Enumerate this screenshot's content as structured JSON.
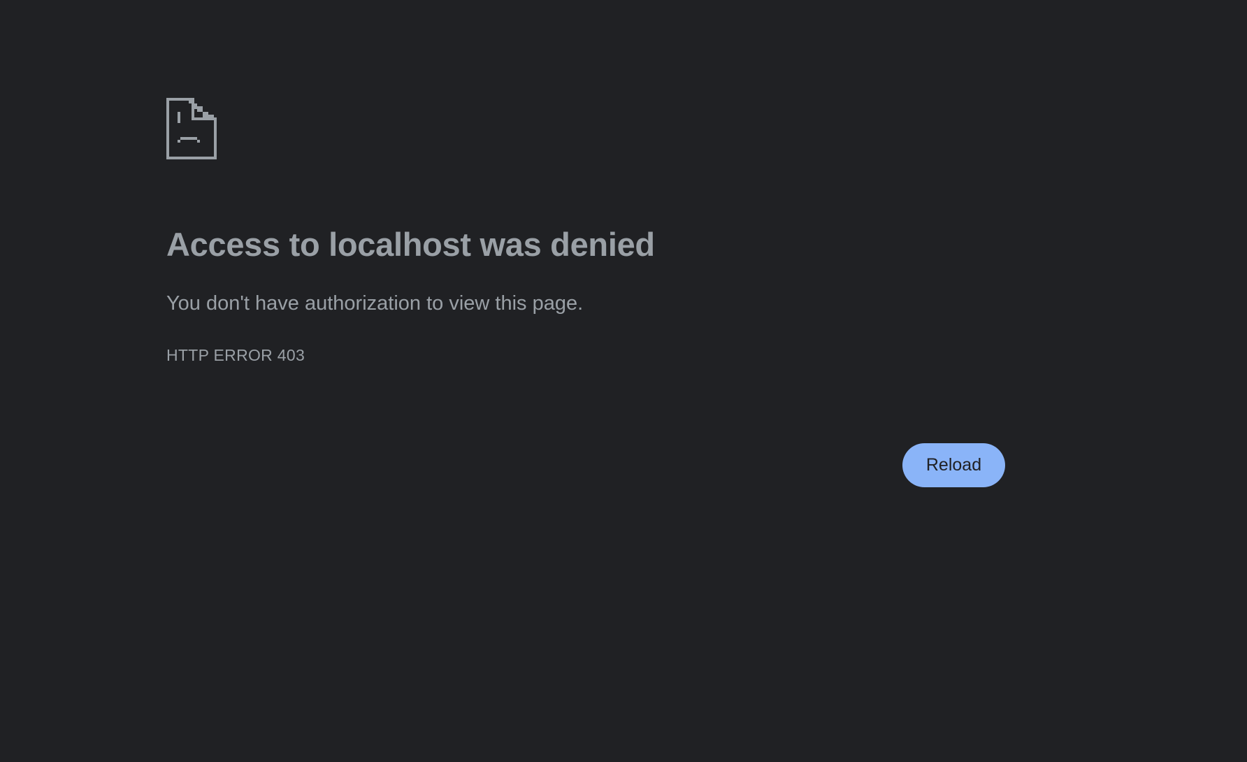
{
  "page": {
    "background_color": "#202124",
    "text_color": "#9aa0a6",
    "accent_color": "#8ab4f8"
  },
  "error": {
    "icon": "sad-document-icon",
    "title": "Access to localhost was denied",
    "message": "You don't have authorization to view this page.",
    "code": "HTTP ERROR 403"
  },
  "actions": {
    "reload_label": "Reload"
  }
}
